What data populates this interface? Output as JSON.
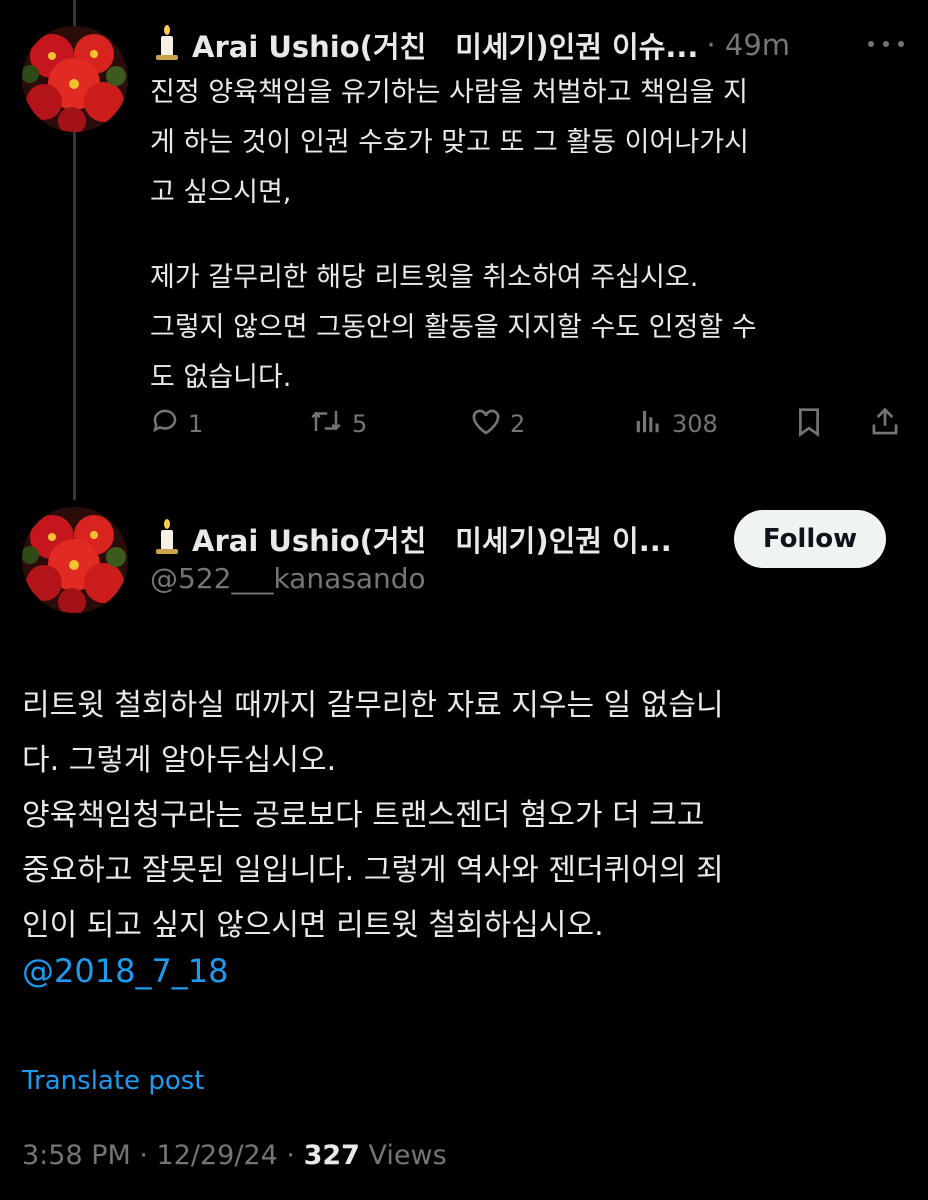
{
  "tweet1": {
    "name": "Arai Ushio(거친　미세기)인권 이슈...",
    "time": "· 49m",
    "text_lines": [
      "진정 양육책임을 유기하는 사람을 처벌하고 책임을 지",
      "게 하는 것이 인권 수호가 맞고 또 그 활동 이어나가시",
      "고 싶으시면,",
      "제가 갈무리한 해당 리트윗을 취소하여 주십시오.",
      "그렇지 않으면 그동안의 활동을 지지할 수도 인정할 수",
      "도 없습니다."
    ],
    "actions": {
      "replies": "1",
      "reposts": "5",
      "likes": "2",
      "views": "308"
    }
  },
  "tweet2": {
    "name": "Arai Ushio(거친　미세기)인권 이...",
    "handle": "@522___kanasando",
    "follow_label": "Follow",
    "text_lines": [
      "리트윗 철회하실 때까지 갈무리한 자료 지우는 일 없습니",
      "다. 그렇게 알아두십시오.",
      "양육책임청구라는 공로보다 트랜스젠더 혐오가 더 크고",
      "중요하고 잘못된 일입니다. 그렇게 역사와 젠더퀴어의 죄",
      "인이 되고 싶지 않으시면 리트윗 철회하십시오."
    ],
    "mention": "@2018_7_18",
    "translate_label": "Translate post",
    "timestamp": "3:58 PM · 12/29/24 · ",
    "views_count": "327",
    "views_label": " Views"
  },
  "colors": {
    "background": "#000000",
    "text": "#e7e9ea",
    "muted": "#71767b",
    "link": "#1d9bf0",
    "follow_bg": "#eff3f4"
  },
  "icons": [
    "candle-icon",
    "more-icon",
    "reply-icon",
    "repost-icon",
    "like-icon",
    "views-icon",
    "bookmark-icon",
    "share-icon"
  ]
}
